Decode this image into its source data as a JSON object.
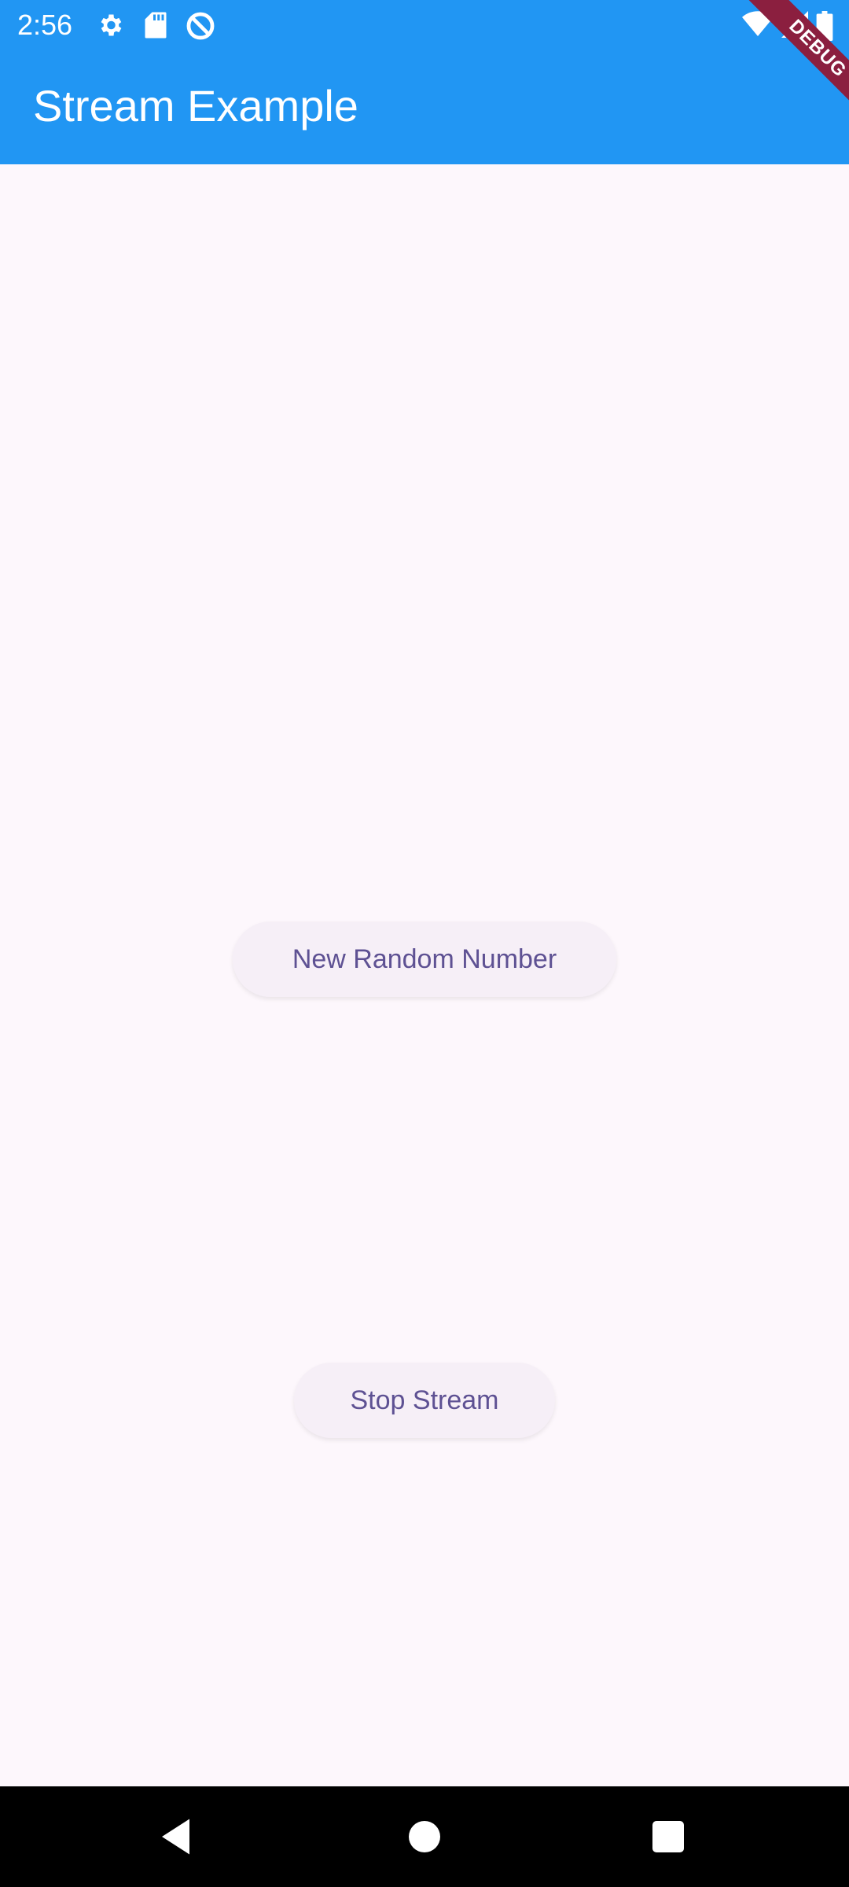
{
  "status_bar": {
    "time": "2:56",
    "left_icons": [
      "gear-icon",
      "sd-card-icon",
      "do-not-disturb-icon"
    ],
    "right_icons": [
      "wifi-icon",
      "cellular-signal-icon",
      "battery-icon"
    ]
  },
  "debug_banner": "DEBUG",
  "app_bar": {
    "title": "Stream Example"
  },
  "main": {
    "random_button_label": "New Random Number",
    "stop_button_label": "Stop Stream"
  },
  "nav_bar": {
    "icons": [
      "back-icon",
      "home-icon",
      "recents-icon"
    ]
  },
  "colors": {
    "app_bar": "#2196f3",
    "background": "#fdf7fc",
    "button_bg": "#f6eff7",
    "button_text": "#5e5193",
    "debug_ribbon": "#8b1f3f",
    "nav_bar": "#000000"
  }
}
